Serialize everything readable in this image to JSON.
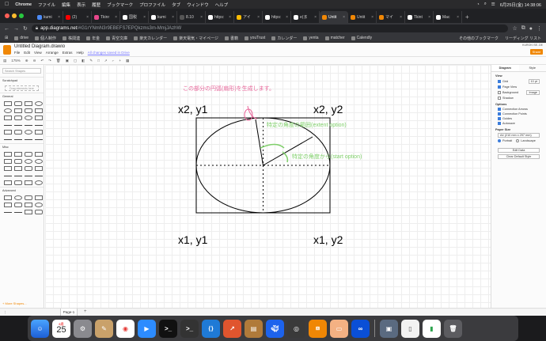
{
  "menubar": {
    "app": "Chrome",
    "items": [
      "ファイル",
      "編集",
      "表示",
      "履歴",
      "ブックマーク",
      "プロファイル",
      "タブ",
      "ウィンドウ",
      "ヘルプ"
    ],
    "datetime": "6月25日(金)  14:38:06"
  },
  "tabs": [
    {
      "label": "kumi",
      "color": "#4c8bf5"
    },
    {
      "label": "(2) ",
      "color": "#ff0000"
    },
    {
      "label": "Tkinr",
      "color": "#e8478b"
    },
    {
      "label": "国税",
      "color": "#ffffff"
    },
    {
      "label": "kumi",
      "color": "#ffffff"
    },
    {
      "label": "8.10",
      "color": "#555555"
    },
    {
      "label": "https:",
      "color": "#ffffff"
    },
    {
      "label": "アイ",
      "color": "#fbbc04"
    },
    {
      "label": "https:",
      "color": "#ffffff"
    },
    {
      "label": "e(ま",
      "color": "#ffffff"
    },
    {
      "label": "Untit",
      "color": "#f08705",
      "active": true
    },
    {
      "label": "Untit",
      "color": "#f08705"
    },
    {
      "label": "マイ",
      "color": "#f08705"
    },
    {
      "label": "Tkint",
      "color": "#ffffff"
    },
    {
      "label": "Mac",
      "color": "#ffffff"
    }
  ],
  "address": {
    "host": "app.diagrams.net",
    "path": "/#G1rYNmN3r9EBEFS7EPQkzms3m-MmjJAzhW"
  },
  "bookmarks": {
    "items": [
      "drive",
      "個人制作",
      "株関連",
      "年金",
      "青空文庫",
      "楽天カレンダー",
      "楽天電気・マイページ",
      "書籍",
      "youTrust",
      "カレンダー",
      "yenta",
      "matcher",
      "Calendly"
    ],
    "other": "その他のブックマーク",
    "reading": "リーディング リスト"
  },
  "drawio": {
    "title": "Untitled Diagram.drawio",
    "menu": [
      "File",
      "Edit",
      "View",
      "Arrange",
      "Extras",
      "Help"
    ],
    "saved": "All changes saved in Drive",
    "share": "Share",
    "account": "KUROKI SE..DE",
    "zoom": "175%"
  },
  "left_panel": {
    "search": "Search Shapes",
    "scratchpad": "Scratchpad",
    "drag_here": "Drag elements here",
    "general": "General",
    "misc": "Misc",
    "advanced": "Advanced",
    "more": "+ More Shapes..."
  },
  "canvas": {
    "labels": {
      "tl": "x2, y1",
      "tr": "x2, y2",
      "bl": "x1, y1",
      "br": "x1, y2"
    },
    "note_arc": "この部分の円弧(扇形)を生成します。",
    "note_extent": "特定の角度の範囲(extent option)",
    "note_start": "特定の角度から(start option)",
    "colors": {
      "pink": "#e8669a",
      "green": "#7fcf6a"
    }
  },
  "right_panel": {
    "tab_diagram": "Diagram",
    "tab_style": "Style",
    "view": "View",
    "grid": "Grid",
    "grid_size": "10 pt",
    "page_view": "Page View",
    "background": "Background",
    "shadow": "Shadow",
    "image": "Image",
    "options": "Options",
    "connection_arrows": "Connection Arrows",
    "connection_points": "Connection Points",
    "guides": "Guides",
    "autosave": "Autosave",
    "paper_size": "Paper Size",
    "paper_value": "A4 (210 mm x 297 mm)",
    "portrait": "Portrait",
    "landscape": "Landscape",
    "edit_data": "Edit Data",
    "clear_default": "Clear Default Style"
  },
  "page_tab": "Page-1",
  "dock": {
    "calendar_month": "6月",
    "calendar_day": "25"
  }
}
